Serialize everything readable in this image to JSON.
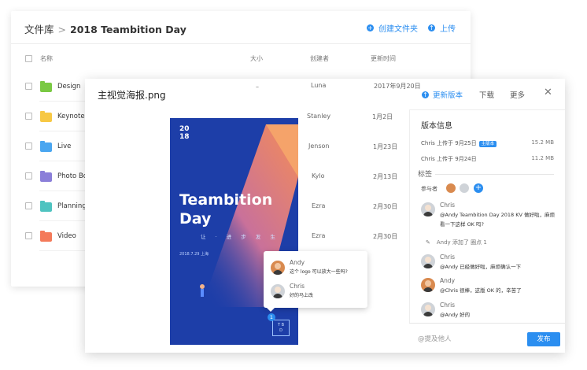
{
  "library": {
    "breadcrumb_root": "文件库",
    "breadcrumb_sep": ">",
    "breadcrumb_current": "2018 Teambition Day",
    "create_folder": "创建文件夹",
    "upload": "上传",
    "columns": {
      "name": "名称",
      "size": "大小",
      "creator": "创建者",
      "updated": "更新时间"
    },
    "folders": [
      {
        "name": "Design",
        "color": "#7ac943"
      },
      {
        "name": "Keynotes",
        "color": "#f7c844"
      },
      {
        "name": "Live",
        "color": "#4aa6f0"
      },
      {
        "name": "Photo Book",
        "color": "#8b7fd9"
      },
      {
        "name": "Planning",
        "color": "#4fc3c0"
      },
      {
        "name": "Video",
        "color": "#f47a5a"
      }
    ],
    "rows_meta": [
      {
        "size": "–",
        "creator": "Luna",
        "updated": "2017年9月20日"
      },
      {
        "size": "–",
        "creator": "Stanley",
        "updated": "1月2日"
      },
      {
        "size": "–",
        "creator": "Jenson",
        "updated": "1月23日"
      },
      {
        "size": "–",
        "creator": "Kylo",
        "updated": "2月13日"
      },
      {
        "size": "–",
        "creator": "Ezra",
        "updated": "2月30日"
      },
      {
        "size": "–",
        "creator": "Ezra",
        "updated": "2月30日"
      }
    ]
  },
  "preview": {
    "title": "主视觉海报.png",
    "update_version": "更新版本",
    "download": "下载",
    "more": "更多",
    "close": "✕",
    "poster": {
      "number": "20\n18",
      "headline_1": "Teambition",
      "headline_2": "Day",
      "subline": "让 · 进 步 发 生",
      "date": "2018.7.29 上海",
      "logo": "T B\nD"
    },
    "popover": [
      {
        "name": "Andy",
        "text": "这个 logo 可以放大一些吗?",
        "avatar": "andy"
      },
      {
        "name": "Chris",
        "text": "好的马上改",
        "avatar": "chris"
      }
    ],
    "pin_count": "1"
  },
  "sidebar": {
    "version_title": "版本信息",
    "versions": [
      {
        "text": "Chris 上传于 9月25日",
        "badge": "主版本",
        "size": "15.2 MB"
      },
      {
        "text": "Chris 上传于 9月24日",
        "badge": "",
        "size": "11.2 MB"
      }
    ],
    "tag_title": "标签",
    "participants_label": "参与者",
    "comments": [
      {
        "name": "Chris",
        "text": "@Andy Teambition Day 2018 KV 做好啦，麻烦看一下这样 OK 吗?",
        "avatar": "chris"
      },
      {
        "name": "Chris",
        "text": "@Andy 已经做好啦，麻烦确认一下",
        "avatar": "chris"
      },
      {
        "name": "Andy",
        "text": "@Chris 很棒，这版 OK 的，辛苦了",
        "avatar": "andy"
      },
      {
        "name": "Chris",
        "text": "@Andy 好的",
        "avatar": "chris"
      }
    ],
    "activity": "Andy 添加了 圈点 1",
    "input_placeholder": "@提及他人",
    "send": "发布"
  },
  "colors": {
    "accent": "#2b8ef0",
    "poster_bg": "#1d3ea8",
    "poster_light": "#f08a5d"
  }
}
